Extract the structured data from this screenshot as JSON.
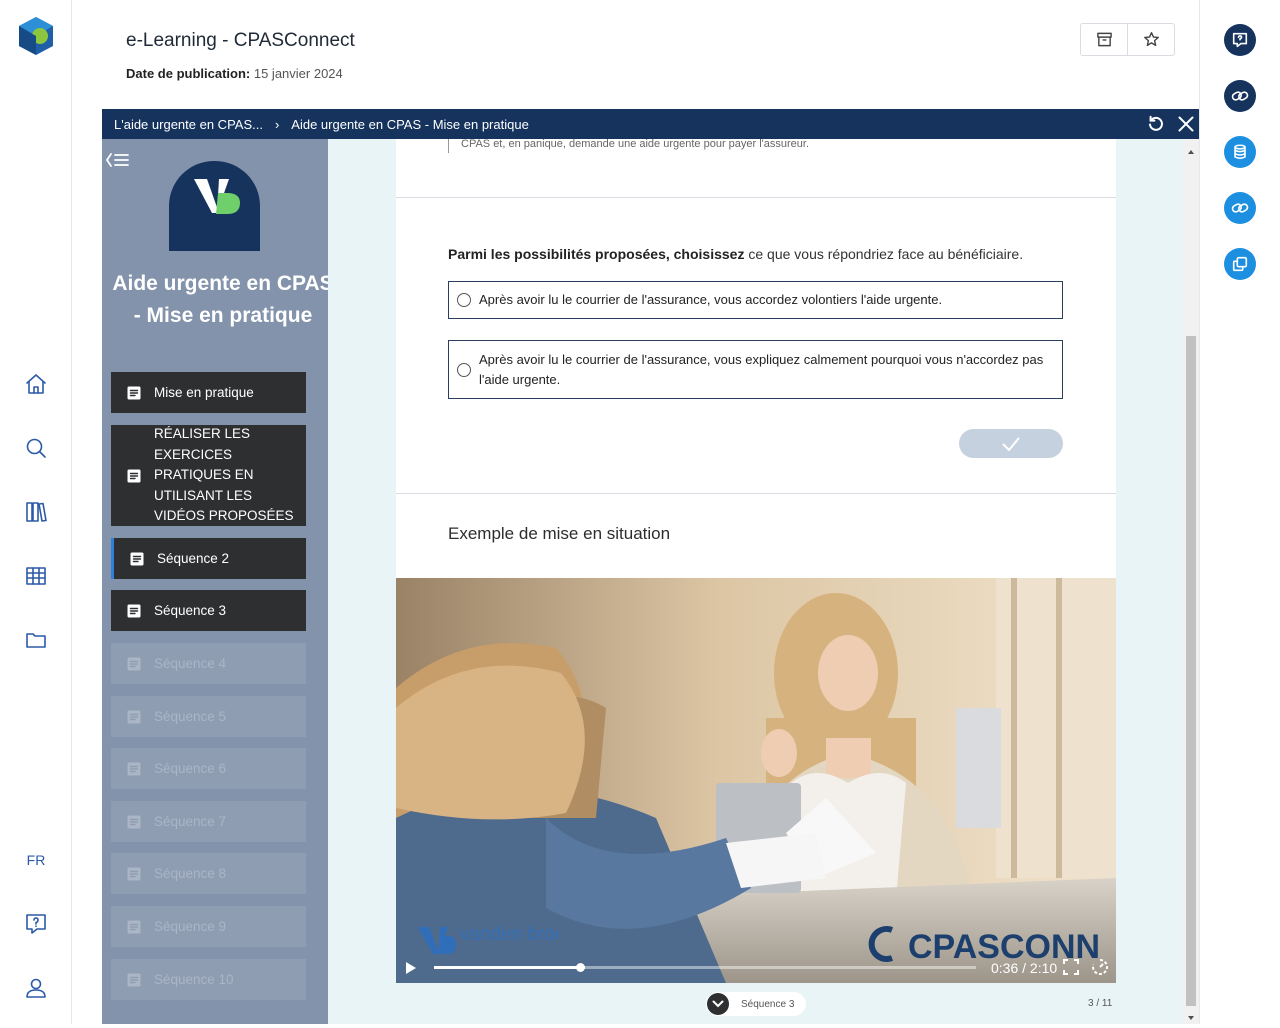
{
  "app": {
    "name": "CPASConnect"
  },
  "left_rail": {
    "items": [
      {
        "name": "home-icon"
      },
      {
        "name": "search-icon"
      },
      {
        "name": "library-icon"
      },
      {
        "name": "grid-icon"
      },
      {
        "name": "folder-icon"
      }
    ],
    "language": "FR"
  },
  "header": {
    "title": "e-Learning - CPASConnect",
    "pub_label": "Date de publication:",
    "pub_date": "15 janvier 2024"
  },
  "course_bar": {
    "crumb_parent": "L'aide urgente en CPAS...",
    "separator": "›",
    "crumb_current": "Aide urgente en CPAS - Mise en pratique"
  },
  "sidebar": {
    "logo_text": "VB",
    "course_title": "Aide urgente en CPAS - Mise en pratique",
    "items": [
      {
        "label": "Mise en pratique",
        "state": "active"
      },
      {
        "label": "RÉALISER LES EXERCICES PRATIQUES EN UTILISANT LES VIDÉOS PROPOSÉES",
        "state": "active"
      },
      {
        "label": "Séquence 2",
        "state": "active"
      },
      {
        "label": "Séquence 3",
        "state": "active"
      },
      {
        "label": "Séquence 4",
        "state": "locked"
      },
      {
        "label": "Séquence 5",
        "state": "locked"
      },
      {
        "label": "Séquence 6",
        "state": "locked"
      },
      {
        "label": "Séquence 7",
        "state": "locked"
      },
      {
        "label": "Séquence 8",
        "state": "locked"
      },
      {
        "label": "Séquence 9",
        "state": "locked"
      },
      {
        "label": "Séquence 10",
        "state": "locked"
      }
    ]
  },
  "content": {
    "quote_tail": "CPAS et, en panique, demande une aide urgente pour payer l'assureur.",
    "question_bold": "Parmi les possibilités proposées, choisissez",
    "question_rest": " ce que vous répondriez face au bénéficiaire.",
    "options": [
      "Après avoir lu le courrier de l'assurance, vous accordez volontiers l'aide urgente.",
      "Après avoir lu le courrier de l'assurance, vous expliquez calmement pourquoi vous n'accordez pas l'aide urgente."
    ],
    "section_title": "Exemple de mise en situation"
  },
  "video": {
    "time": "0:36 / 2:10",
    "progress": 0.27,
    "watermark_left": "vanden broele.",
    "watermark_right": "CPASCONNECT"
  },
  "footer": {
    "sequence_label": "Séquence 3",
    "pager": "3 / 11"
  },
  "colors": {
    "navy": "#15335d",
    "sidebar": "#8393ab",
    "accent": "#1d8fe0",
    "content_bg": "#e9f4f7"
  }
}
